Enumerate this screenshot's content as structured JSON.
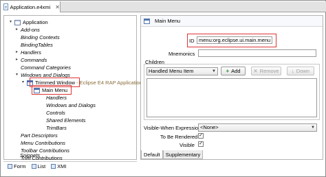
{
  "editor": {
    "tab_title": "Application.e4xmi",
    "close_glyph": "✕"
  },
  "tree": {
    "items": [
      {
        "label": "Application",
        "italic": false,
        "twisty": "open",
        "icon": "app-icon"
      },
      {
        "label": "Add-ons",
        "italic": true,
        "twisty": "closed"
      },
      {
        "label": "Binding Contexts",
        "italic": true,
        "twisty": "none"
      },
      {
        "label": "BindingTables",
        "italic": true,
        "twisty": "none"
      },
      {
        "label": "Handlers",
        "italic": true,
        "twisty": "closed"
      },
      {
        "label": "Commands",
        "italic": true,
        "twisty": "closed"
      },
      {
        "label": "Command Categories",
        "italic": true,
        "twisty": "none"
      },
      {
        "label": "Windows and Dialogs",
        "italic": true,
        "twisty": "open"
      },
      {
        "label": "Trimmed Window",
        "italic": false,
        "twisty": "open",
        "icon": "window-icon",
        "suffix": "- Eclipse E4 RAP Application"
      },
      {
        "label": "Main Menu",
        "italic": false,
        "twisty": "none",
        "icon": "menu-icon"
      },
      {
        "label": "Handlers",
        "italic": true,
        "twisty": "none"
      },
      {
        "label": "Windows and Dialogs",
        "italic": true,
        "twisty": "none"
      },
      {
        "label": "Controls",
        "italic": true,
        "twisty": "none"
      },
      {
        "label": "Shared Elements",
        "italic": true,
        "twisty": "none"
      },
      {
        "label": "TrimBars",
        "italic": true,
        "twisty": "none"
      },
      {
        "label": "Part Descriptors",
        "italic": true,
        "twisty": "none"
      },
      {
        "label": "Menu Contributions",
        "italic": true,
        "twisty": "none"
      },
      {
        "label": "Toolbar Contributions",
        "italic": true,
        "twisty": "none"
      },
      {
        "label": "Trim Contributions",
        "italic": true,
        "twisty": "none"
      },
      {
        "label": "Snippets",
        "italic": true,
        "twisty": "none"
      }
    ]
  },
  "bottom_tabs": [
    {
      "label": "Form"
    },
    {
      "label": "List"
    },
    {
      "label": "XMI"
    }
  ],
  "detail": {
    "title": "Main Menu",
    "id_label": "ID",
    "id_value": "menu:org.eclipse.ui.main.menu",
    "mnemonics_label": "Mnemonics",
    "mnemonics_value": "",
    "children_label": "Children",
    "children_combo": "Handled Menu Item",
    "add_button": "Add",
    "remove_button": "Remove",
    "down_button": "Down",
    "visible_when_label": "Visible-When Expression",
    "visible_when_value": "<None>",
    "to_be_rendered_label": "To Be Rendered",
    "visible_label": "Visible",
    "check_glyph": "✓",
    "tabs": [
      {
        "label": "Default"
      },
      {
        "label": "Supplementary"
      }
    ]
  },
  "colors": {
    "highlight_border": "#dd3333"
  }
}
